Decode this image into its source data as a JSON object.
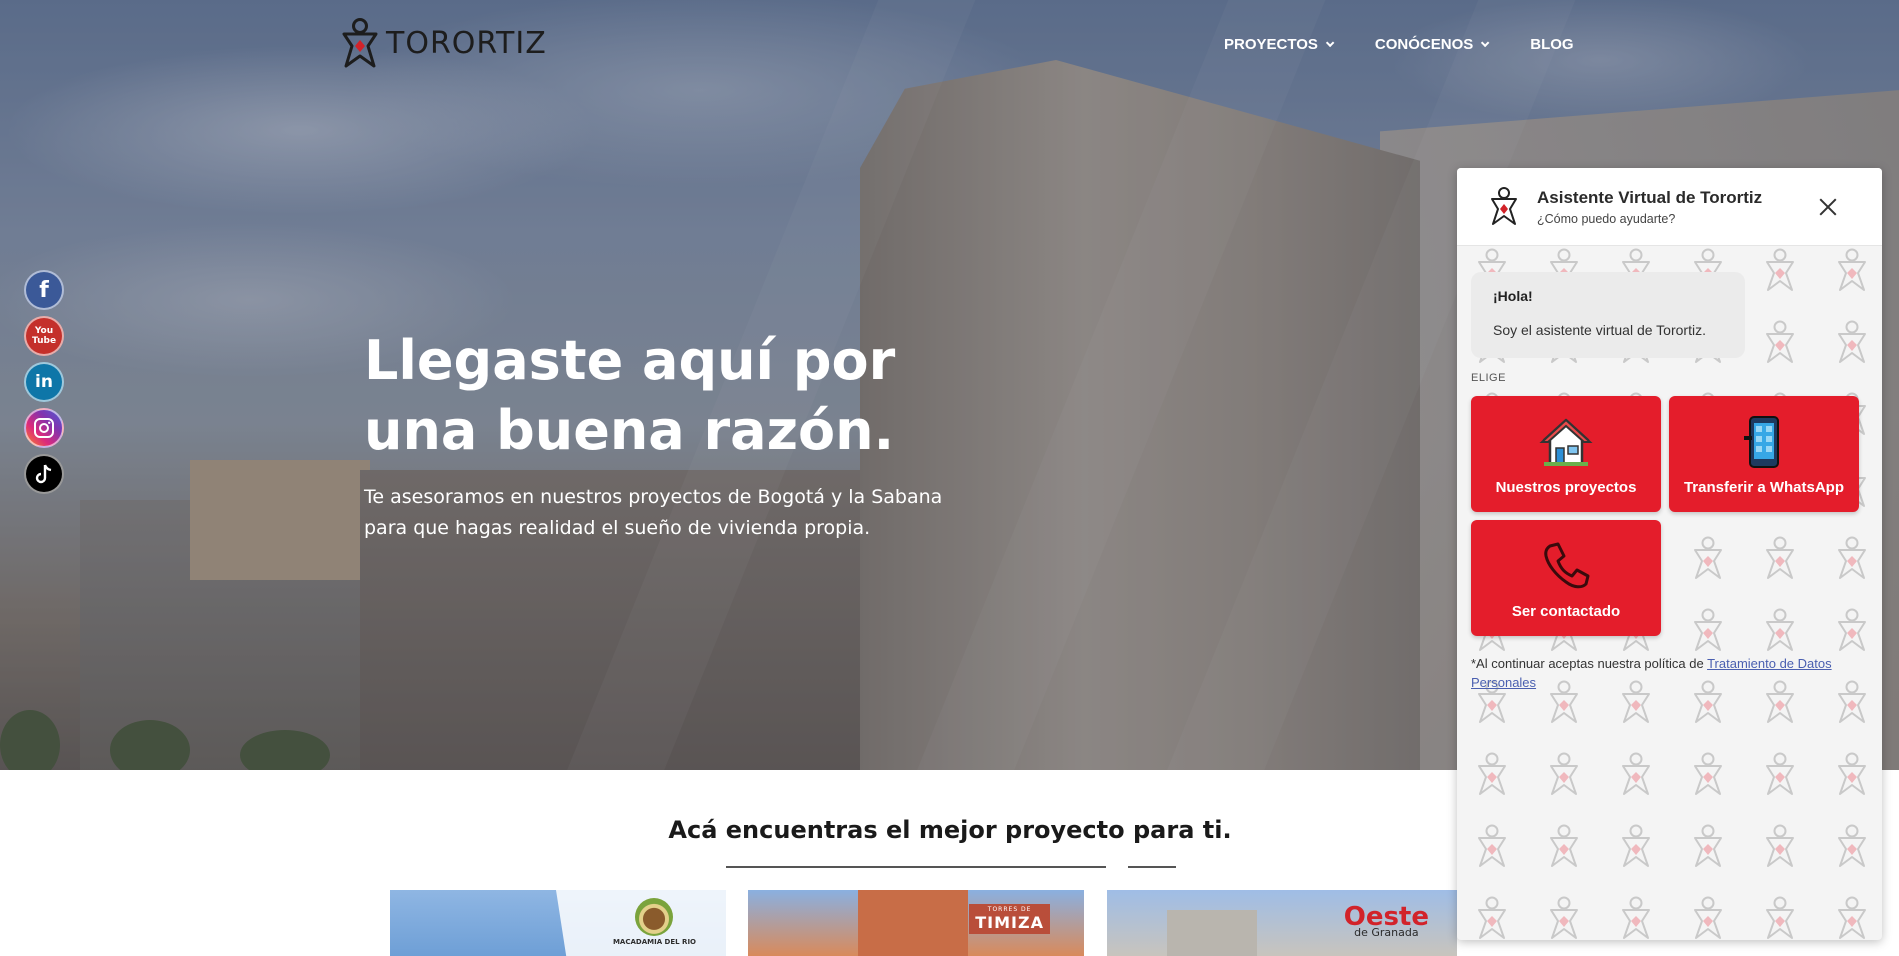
{
  "brand": {
    "name": "TORORTIZ"
  },
  "nav": {
    "items": [
      {
        "label": "PROYECTOS",
        "dropdown": true
      },
      {
        "label": "CONÓCENOS",
        "dropdown": true
      },
      {
        "label": "BLOG",
        "dropdown": false
      }
    ]
  },
  "social": {
    "items": [
      {
        "name": "facebook-icon",
        "glyph": "f"
      },
      {
        "name": "youtube-icon",
        "glyph": "You Tube"
      },
      {
        "name": "linkedin-icon",
        "glyph": "in"
      },
      {
        "name": "instagram-icon",
        "glyph": ""
      },
      {
        "name": "tiktok-icon",
        "glyph": ""
      }
    ]
  },
  "hero": {
    "title_line1": "Llegaste aquí por",
    "title_line2": "una buena razón.",
    "subtitle_line1": "Te asesoramos en nuestros proyectos de Bogotá y la Sabana",
    "subtitle_line2": "para que hagas realidad el sueño de vivienda propia."
  },
  "section": {
    "title": "Acá encuentras el mejor proyecto para ti."
  },
  "projects": [
    {
      "logo_text": "MACADAMIA DEL RIO"
    },
    {
      "logo_small": "TORRES DE",
      "logo_text": "TIMIZA"
    },
    {
      "logo_text": "Oeste",
      "logo_small": "de Granada"
    }
  ],
  "chat": {
    "title": "Asistente Virtual de Torortiz",
    "subtitle": "¿Cómo puedo ayudarte?",
    "greeting": "¡Hola!",
    "intro": "Soy el asistente virtual de Torortiz.",
    "choose_label": "ELIGE",
    "options": [
      {
        "label": "Nuestros proyectos",
        "icon": "house-icon"
      },
      {
        "label": "Transferir a WhatsApp",
        "icon": "phone-mobile-icon"
      },
      {
        "label": "Ser contactado",
        "icon": "telephone-icon"
      }
    ],
    "consent_prefix": "*Al continuar aceptas nuestra política de ",
    "consent_link": "Tratamiento de Datos Personales"
  },
  "colors": {
    "accent": "#e41d2b",
    "link": "#4a5fb0"
  }
}
